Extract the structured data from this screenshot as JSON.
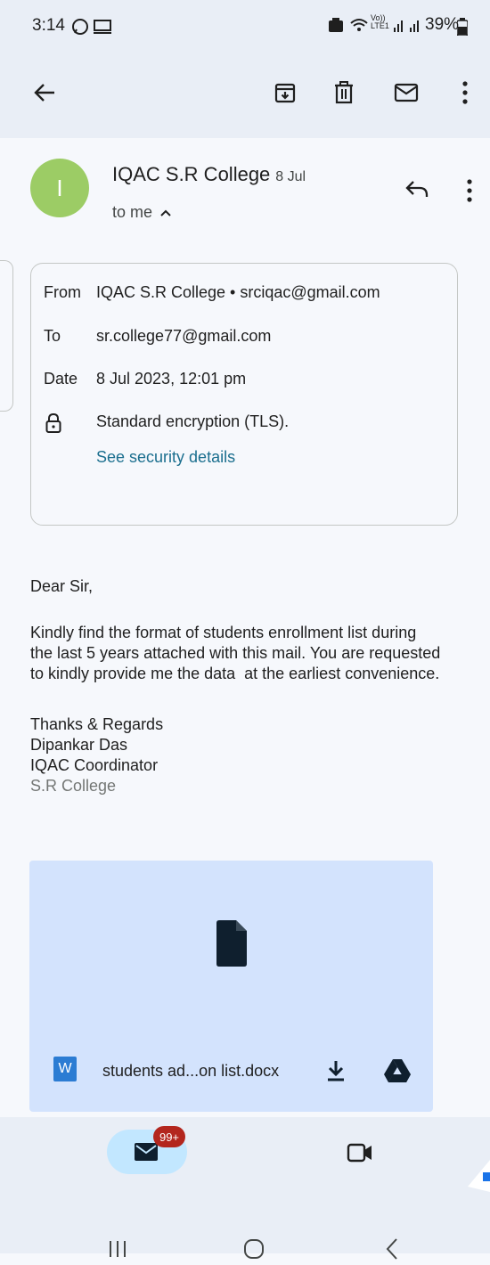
{
  "status": {
    "time": "3:14",
    "volte": "Vo))\nLTE1",
    "battery": "39%"
  },
  "email": {
    "sender_initial": "I",
    "sender_name": "IQAC S.R College",
    "date_short": "8 Jul",
    "recipient_summary": "to me"
  },
  "details": {
    "from_label": "From",
    "from_value": "IQAC S.R College • srciqac@gmail.com",
    "to_label": "To",
    "to_value": "sr.college77@gmail.com",
    "date_label": "Date",
    "date_value": "8 Jul 2023, 12:01 pm",
    "encryption": "Standard encryption (TLS).",
    "security_link": "See security details"
  },
  "body": {
    "greeting": "Dear Sir,",
    "para_line1": "Kindly find the format of students enrollment list during",
    "para_line2": "the last 5 years attached with this mail. You are requested",
    "para_line3": "to kindly provide me the data  at the earliest convenience.",
    "sign_line1": "Thanks & Regards",
    "sign_line2": "Dipankar Das",
    "sign_line3": "IQAC Coordinator",
    "sign_line4": "S.R College"
  },
  "attachment": {
    "type_badge": "W",
    "file_name": "students ad...on list.docx"
  },
  "bottom_nav": {
    "mail_badge": "99+"
  },
  "colors": {
    "avatar": "#9ccc65",
    "link": "#1a6e8e",
    "attachment_bg": "#d3e3fd",
    "badge": "#b3261e",
    "word_blue": "#2b7cd3"
  }
}
